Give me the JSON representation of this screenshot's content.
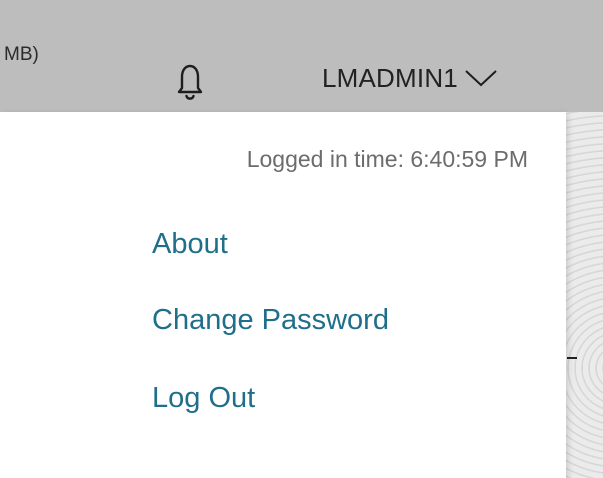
{
  "header": {
    "partial_text": "MB)",
    "username": "LMADMIN1",
    "icons": {
      "notifications": "bell-icon",
      "user_menu_toggle": "chevron-down-icon"
    }
  },
  "user_menu": {
    "logged_in_time": "Logged in time: 6:40:59 PM",
    "items": [
      {
        "label": "About"
      },
      {
        "label": "Change Password"
      },
      {
        "label": "Log Out"
      }
    ]
  },
  "colors": {
    "header_bg": "#bdbdbd",
    "link": "#1f6f8b",
    "muted_text": "#6c6c6c"
  }
}
